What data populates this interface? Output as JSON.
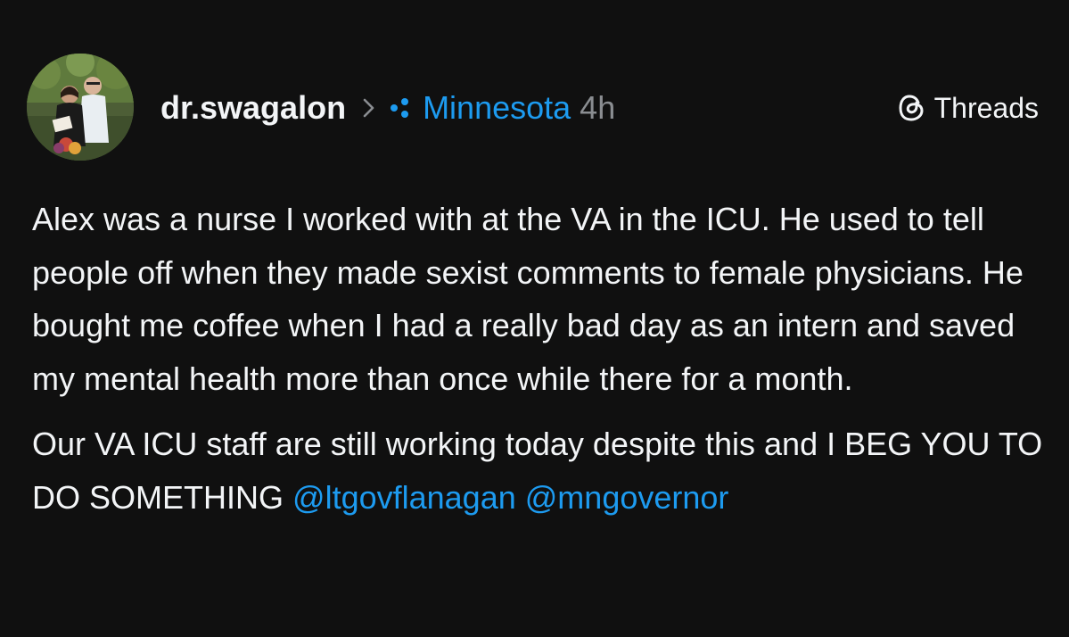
{
  "post": {
    "username": "dr.swagalon",
    "separator_icon": "chevron-right-icon",
    "community_icon": "community-dots-icon",
    "community": "Minnesota",
    "time": "4h",
    "brand_icon": "threads-logo-icon",
    "brand": "Threads",
    "paragraph1": "Alex was a nurse I worked with at the VA in the ICU. He used to tell people off when they made sexist comments to female physicians. He bought me coffee when I had a really bad day as an intern and saved my mental health more than once while there for a month.",
    "paragraph2_text": "Our VA ICU staff are still working today despite this and I BEG YOU TO DO SOMETHING",
    "mention1": "@ltgovflanagan",
    "mention2": "@mngovernor"
  },
  "colors": {
    "background": "#101010",
    "text": "#f3f5f7",
    "muted": "#8a8d91",
    "link": "#1d9bf0"
  }
}
